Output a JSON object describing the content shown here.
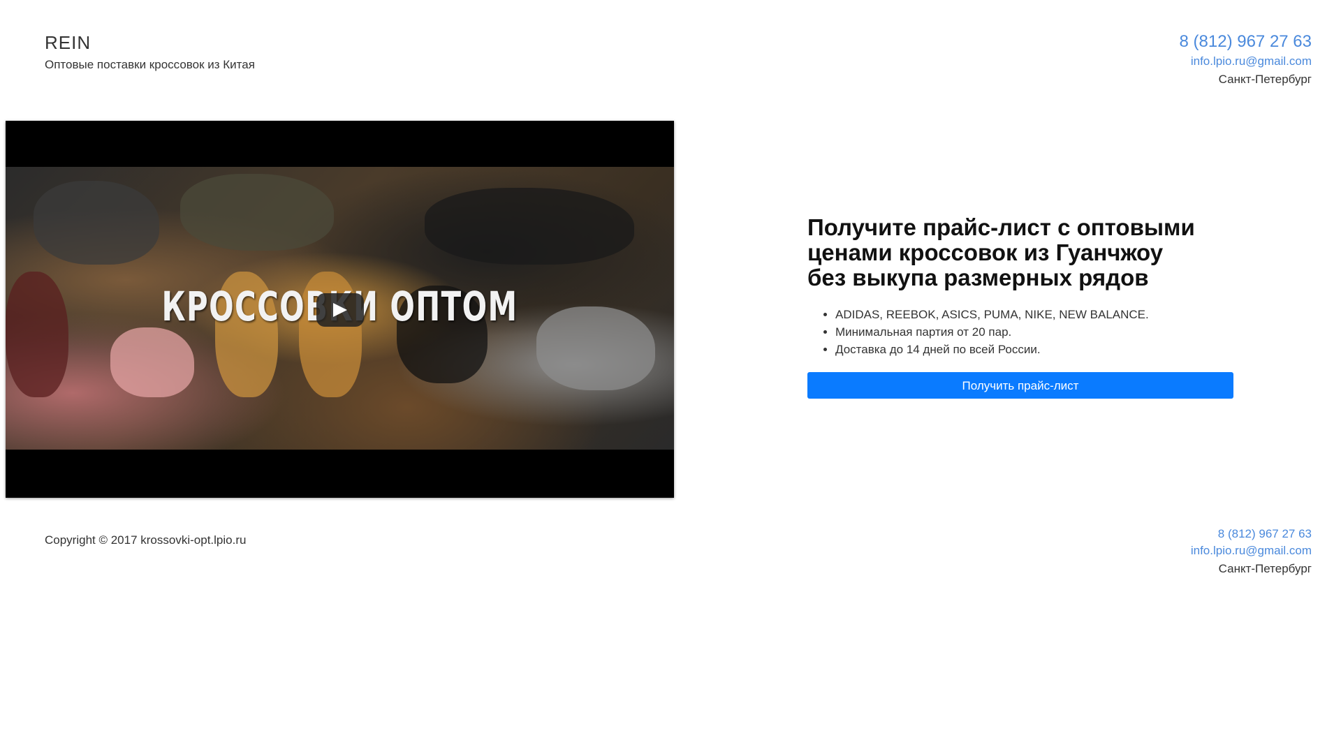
{
  "header": {
    "brand_name": "REIN",
    "tagline": "Оптовые поставки кроссовок из Китая",
    "phone": "8 (812) 967 27 63",
    "email": "info.lpio.ru@gmail.com",
    "city": "Санкт-Петербург"
  },
  "video": {
    "overlay_text": "КРОССОВКИ ОПТОМ",
    "play_icon": "play-icon"
  },
  "offer": {
    "heading_lines": [
      "Получите прайс-лист с оптовыми",
      "ценами кроссовок из Гуанчжоу",
      "без выкупа размерных рядов"
    ],
    "bullets": [
      "ADIDAS, REEBOK, ASICS, PUMA, NIKE, NEW BALANCE.",
      "Минимальная партия от 20 пар.",
      "Доставка до 14 дней по всей России."
    ],
    "button_label": "Получить прайс-лист"
  },
  "footer": {
    "copyright": "Copyright © 2017 krossovki-opt.lpio.ru",
    "phone": "8 (812) 967 27 63",
    "email": "info.lpio.ru@gmail.com",
    "city": "Санкт-Петербург"
  },
  "colors": {
    "accent": "#0a7bff",
    "link": "#4a89dc",
    "text": "#333333"
  }
}
